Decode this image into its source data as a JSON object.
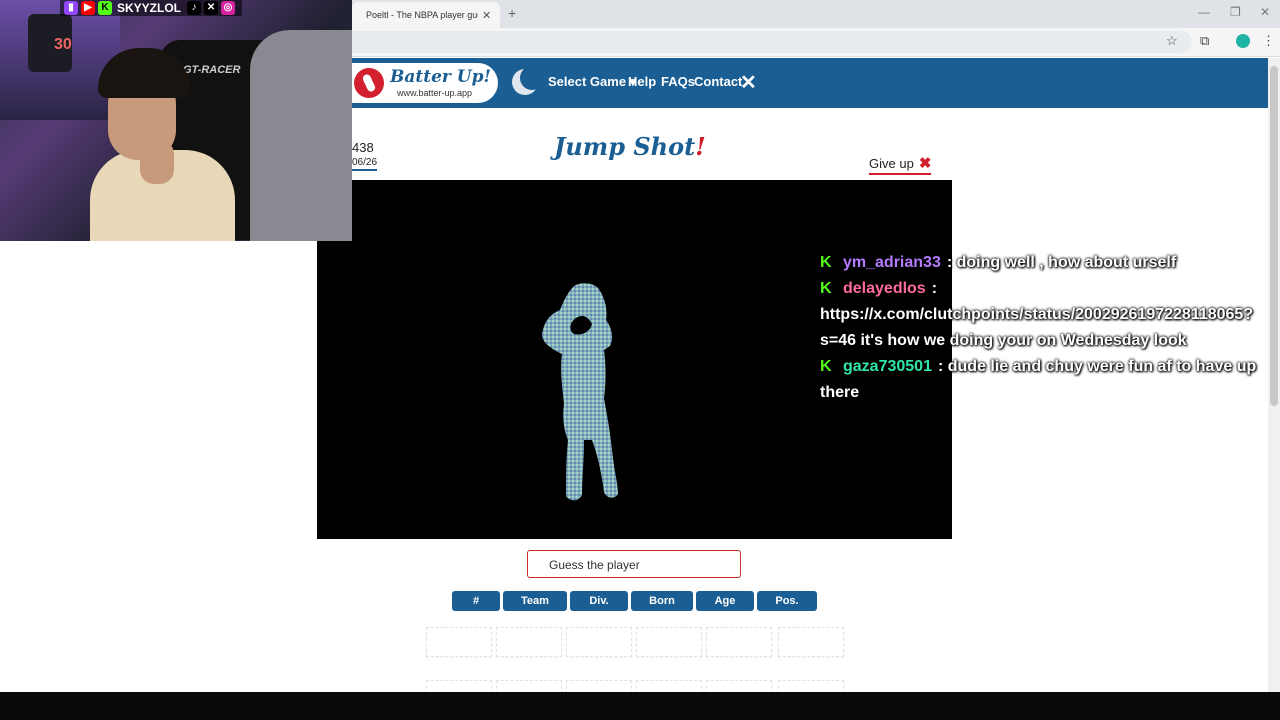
{
  "browser": {
    "tab_title": "Poeltl - The NBPA player guess",
    "tab_close": "✕",
    "new_tab": "+",
    "win_min": "—",
    "win_max": "❐",
    "win_close": "✕",
    "star": "☆",
    "ext": "⧉",
    "menu": "⋮"
  },
  "nav": {
    "logo_title": "Batter Up!",
    "logo_url": "www.batter-up.app",
    "select_game": "Select Game ▾",
    "help": "Help",
    "faqs": "FAQs",
    "contact": "Contact",
    "x_icon": "✕"
  },
  "game": {
    "puzzle_number": "438",
    "date": "06/26",
    "title_main": "Jump Shot",
    "title_bang": "!",
    "give_up": "Give up",
    "give_up_icon": "✖",
    "guess_placeholder": "Guess the player",
    "columns": [
      "#",
      "Team",
      "Div.",
      "Born",
      "Age",
      "Pos."
    ]
  },
  "webcam": {
    "handle": "SKYYZLOL",
    "chair_brand": "GT-RACER",
    "jersey_number": "30"
  },
  "chat": {
    "messages": [
      {
        "user": "ym_adrian33",
        "user_color": "#b57bff",
        "text": ": doing well , how about urself"
      },
      {
        "user": "delayedlos",
        "user_color": "#ff6b9d",
        "text": ": https://x.com/clutchpoints/status/2002926197228118065?s=46 it's how we doing your on Wednesday look"
      },
      {
        "user": "gaza730501",
        "user_color": "#2ee6a8",
        "text": ": dude lie and chuy were fun af to have up there"
      }
    ]
  },
  "colors": {
    "primary": "#1a5e93",
    "accent": "#d3202f",
    "kick_green": "#53fc18"
  }
}
